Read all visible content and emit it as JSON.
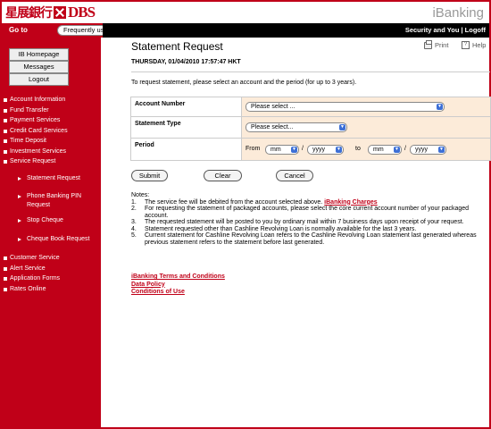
{
  "header": {
    "logo_chinese": "星展銀行",
    "logo_english": "DBS",
    "product": "iBanking"
  },
  "topbar": {
    "goto_label": "Go to",
    "goto_select": "Frequently used services ...",
    "secure_links": "Security and You | Logoff"
  },
  "sidebar": {
    "buttons": [
      "IB Homepage",
      "Messages",
      "Logout"
    ],
    "nav_top": [
      "Account Information",
      "Fund Transfer",
      "Payment Services",
      "Credit Card Services",
      "Time Deposit",
      "Investment Services",
      "Service Request"
    ],
    "sub_items": [
      "Statement Request",
      "Phone Banking PIN Request",
      "Stop Cheque",
      "Cheque Book Request"
    ],
    "nav_bottom": [
      "Customer Service",
      "Alert Service",
      "Application Forms",
      "Rates Online"
    ]
  },
  "main": {
    "title": "Statement Request",
    "print_label": "Print",
    "help_label": "Help",
    "date": "THURSDAY, 01/04/2010 17:57:47 HKT",
    "intro": "To request statement, please select an account and the period (for up to 3 years).",
    "form": {
      "account_label": "Account Number",
      "account_value": "Please select ...",
      "type_label": "Statement Type",
      "type_value": "Please select...",
      "period_label": "Period",
      "from_label": "From",
      "to_label": "to",
      "mm": "mm",
      "yyyy": "yyyy",
      "slash": "/"
    },
    "buttons": {
      "submit": "Submit",
      "clear": "Clear",
      "cancel": "Cancel"
    },
    "notes_title": "Notes:",
    "notes": [
      {
        "num": "1.",
        "text": "The service fee will be debited from the account selected above. ",
        "link": "iBanking Charges"
      },
      {
        "num": "2.",
        "text": "For requesting the statement of packaged accounts, please select the core current account number of your packaged account."
      },
      {
        "num": "3.",
        "text": "The requested statement will be posted to you by ordinary mail within 7 business days upon receipt of your request."
      },
      {
        "num": "4.",
        "text": "Statement requested other than Cashline Revolving Loan is normally available for the last 3 years."
      },
      {
        "num": "5.",
        "text": "Current statement for Cashline Revolving Loan refers to the Cashline Revolving Loan statement last generated whereas previous statement refers to the statement before last generated."
      }
    ],
    "footer_links": [
      "iBanking Terms and Conditions",
      "Data Policy",
      "Conditions of Use"
    ]
  },
  "colors": {
    "brand_red": "#c00018",
    "form_bg": "#fcebd9",
    "select_arrow": "#3d6fd6"
  }
}
